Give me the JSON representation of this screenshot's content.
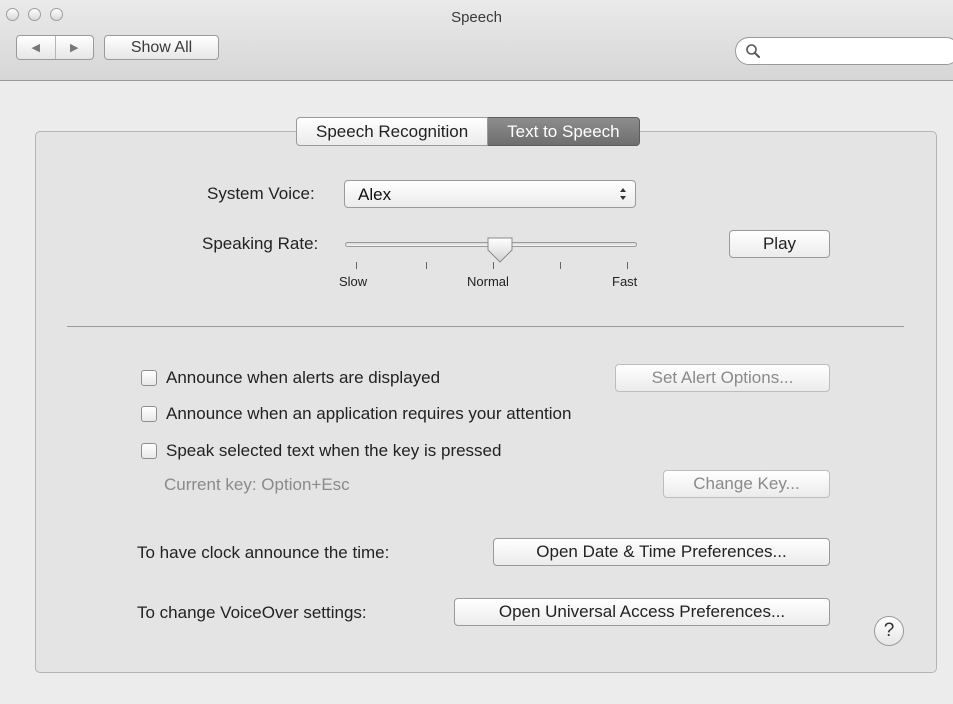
{
  "window": {
    "title": "Speech"
  },
  "toolbar": {
    "back_icon": "◀",
    "forward_icon": "▶",
    "show_all_label": "Show All",
    "search_placeholder": ""
  },
  "tabs": [
    {
      "label": "Speech Recognition",
      "active": false
    },
    {
      "label": "Text to Speech",
      "active": true
    }
  ],
  "voice": {
    "label": "System Voice:",
    "selected": "Alex"
  },
  "rate": {
    "label": "Speaking Rate:",
    "value_fraction": 0.53,
    "min_label": "Slow",
    "mid_label": "Normal",
    "max_label": "Fast",
    "play_label": "Play"
  },
  "options": {
    "announce_alerts": {
      "label": "Announce when alerts are displayed",
      "checked": false
    },
    "set_alert_options": "Set Alert Options...",
    "announce_attention": {
      "label": "Announce when an application requires your attention",
      "checked": false
    },
    "speak_selected": {
      "label": "Speak selected text when the key is pressed",
      "checked": false
    },
    "current_key": "Current key: Option+Esc",
    "change_key": "Change Key..."
  },
  "links": {
    "clock_label": "To have clock announce the time:",
    "clock_button": "Open Date & Time Preferences...",
    "voiceover_label": "To change VoiceOver settings:",
    "voiceover_button": "Open Universal Access Preferences..."
  },
  "help_label": "?"
}
